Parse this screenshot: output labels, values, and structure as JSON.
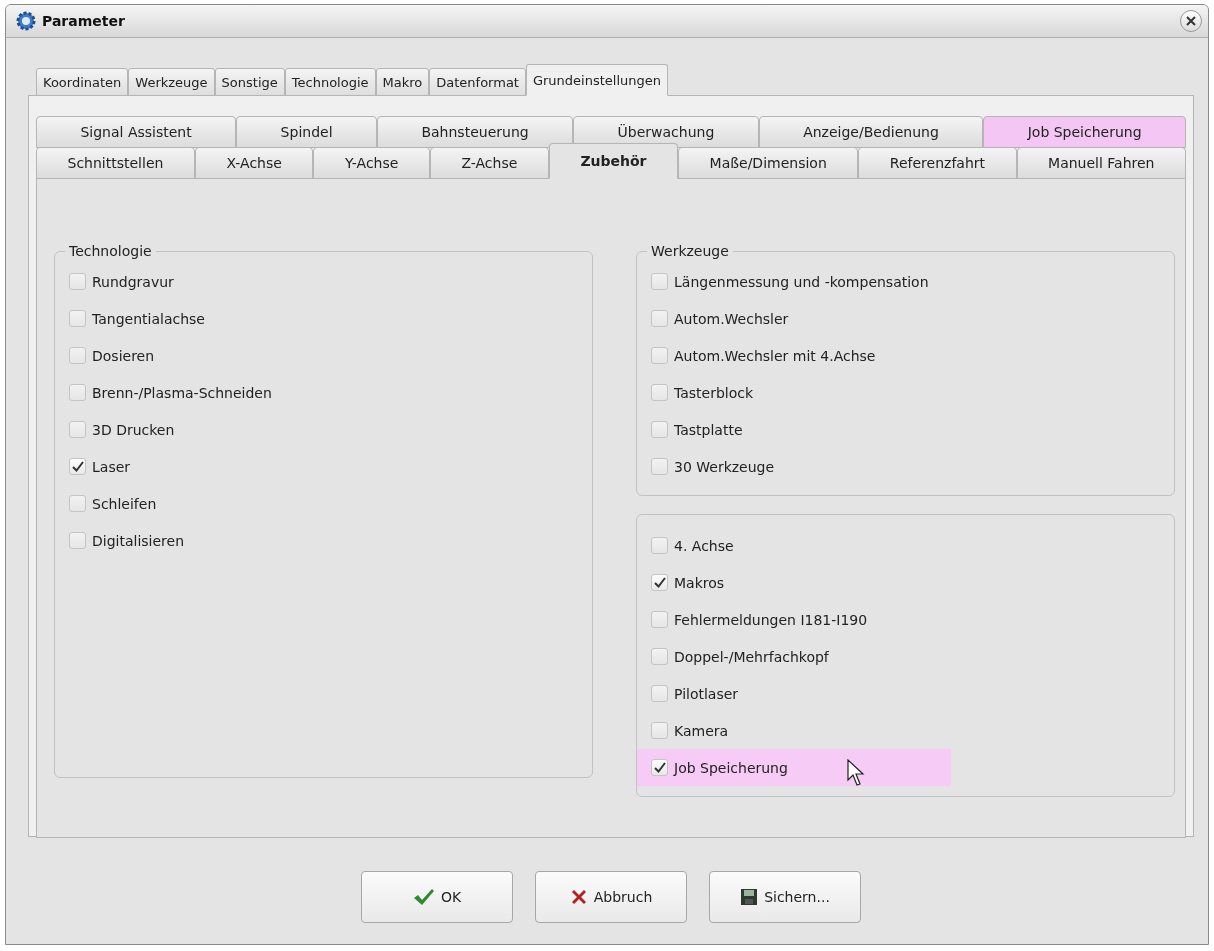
{
  "window": {
    "title": "Parameter"
  },
  "tabs": [
    {
      "label": "Koordinaten",
      "selected": false
    },
    {
      "label": "Werkzeuge",
      "selected": false
    },
    {
      "label": "Sonstige",
      "selected": false
    },
    {
      "label": "Technologie",
      "selected": false
    },
    {
      "label": "Makro",
      "selected": false
    },
    {
      "label": "Datenformat",
      "selected": false
    },
    {
      "label": "Grundeinstellungen",
      "selected": true
    }
  ],
  "subtab_rows": [
    [
      {
        "label": "Signal Assistent",
        "selected": false,
        "highlighted": false
      },
      {
        "label": "Spindel",
        "selected": false,
        "highlighted": false
      },
      {
        "label": "Bahnsteuerung",
        "selected": false,
        "highlighted": false
      },
      {
        "label": "Überwachung",
        "selected": false,
        "highlighted": false
      },
      {
        "label": "Anzeige/Bedienung",
        "selected": false,
        "highlighted": false
      },
      {
        "label": "Job Speicherung",
        "selected": false,
        "highlighted": true
      }
    ],
    [
      {
        "label": "Schnittstellen",
        "selected": false,
        "highlighted": false
      },
      {
        "label": "X-Achse",
        "selected": false,
        "highlighted": false
      },
      {
        "label": "Y-Achse",
        "selected": false,
        "highlighted": false
      },
      {
        "label": "Z-Achse",
        "selected": false,
        "highlighted": false
      },
      {
        "label": "Zubehör",
        "selected": true,
        "highlighted": false
      },
      {
        "label": "Maße/Dimension",
        "selected": false,
        "highlighted": false
      },
      {
        "label": "Referenzfahrt",
        "selected": false,
        "highlighted": false
      },
      {
        "label": "Manuell Fahren",
        "selected": false,
        "highlighted": false
      }
    ]
  ],
  "groups": [
    {
      "title": "Technologie",
      "items": [
        {
          "label": "Rundgravur",
          "checked": false,
          "highlighted": false
        },
        {
          "label": "Tangentialachse",
          "checked": false,
          "highlighted": false
        },
        {
          "label": "Dosieren",
          "checked": false,
          "highlighted": false
        },
        {
          "label": "Brenn-/Plasma-Schneiden",
          "checked": false,
          "highlighted": false
        },
        {
          "label": "3D Drucken",
          "checked": false,
          "highlighted": false
        },
        {
          "label": "Laser",
          "checked": true,
          "highlighted": false
        },
        {
          "label": "Schleifen",
          "checked": false,
          "highlighted": false
        },
        {
          "label": "Digitalisieren",
          "checked": false,
          "highlighted": false
        }
      ]
    },
    {
      "title": "Werkzeuge",
      "items": [
        {
          "label": "Längenmessung und -kompensation",
          "checked": false,
          "highlighted": false
        },
        {
          "label": "Autom.Wechsler",
          "checked": false,
          "highlighted": false
        },
        {
          "label": "Autom.Wechsler mit 4.Achse",
          "checked": false,
          "highlighted": false
        },
        {
          "label": "Tasterblock",
          "checked": false,
          "highlighted": false
        },
        {
          "label": "Tastplatte",
          "checked": false,
          "highlighted": false
        },
        {
          "label": "30 Werkzeuge",
          "checked": false,
          "highlighted": false
        }
      ]
    },
    {
      "items": [
        {
          "label": "4. Achse",
          "checked": false,
          "highlighted": false
        },
        {
          "label": "Makros",
          "checked": true,
          "highlighted": false
        },
        {
          "label": "Fehlermeldungen I181-I190",
          "checked": false,
          "highlighted": false
        },
        {
          "label": "Doppel-/Mehrfachkopf",
          "checked": false,
          "highlighted": false
        },
        {
          "label": "Pilotlaser",
          "checked": false,
          "highlighted": false
        },
        {
          "label": "Kamera",
          "checked": false,
          "highlighted": false
        },
        {
          "label": "Job Speicherung",
          "checked": true,
          "highlighted": true
        }
      ]
    }
  ],
  "buttons": [
    {
      "kind": "ok",
      "label": "OK"
    },
    {
      "kind": "cancel",
      "label": "Abbruch"
    },
    {
      "kind": "save",
      "label": "Sichern..."
    }
  ]
}
